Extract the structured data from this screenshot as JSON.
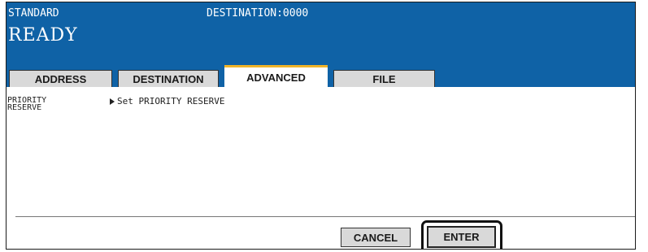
{
  "header": {
    "mode": "STANDARD",
    "destination": "DESTINATION:0000",
    "status": "READY"
  },
  "tabs": [
    {
      "label": "ADDRESS",
      "active": false
    },
    {
      "label": "DESTINATION",
      "active": false
    },
    {
      "label": "ADVANCED",
      "active": true
    },
    {
      "label": "FILE",
      "active": false
    }
  ],
  "setting": {
    "label_line1": "PRIORITY",
    "label_line2": "RESERVE",
    "value": "Set PRIORITY RESERVE"
  },
  "buttons": {
    "cancel": "CANCEL",
    "enter": "ENTER"
  },
  "colors": {
    "header_bg": "#0f62a6",
    "active_tab_accent": "#f0b429",
    "button_bg": "#d9d9d9"
  }
}
